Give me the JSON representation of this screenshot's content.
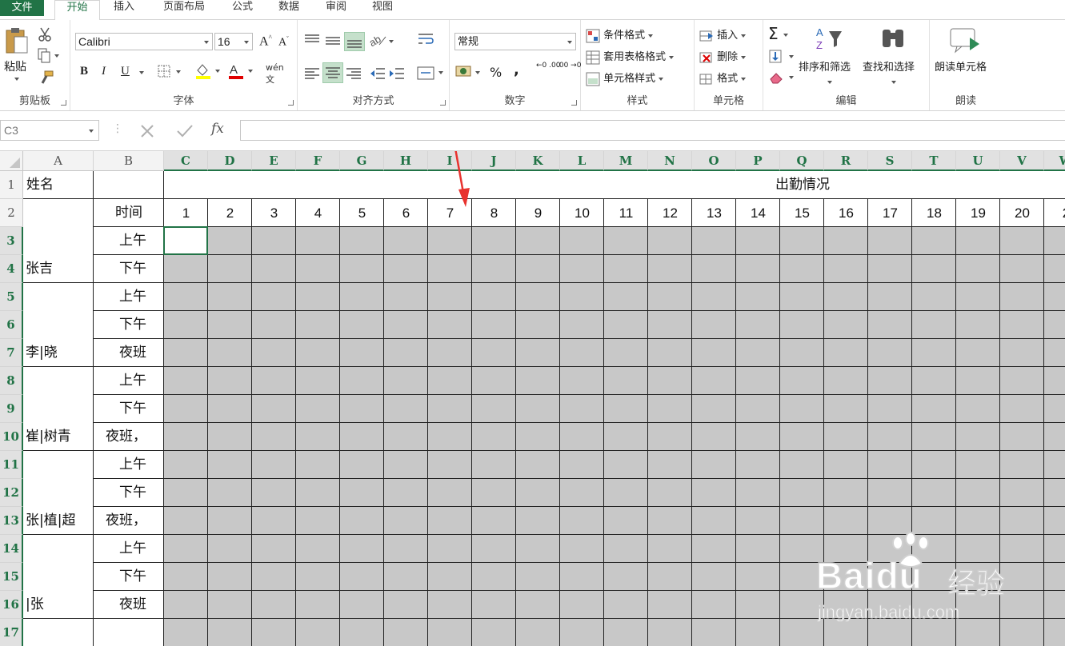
{
  "ribbon_tabs": [
    "文件",
    "开始",
    "插入",
    "页面布局",
    "公式",
    "数据",
    "审阅",
    "视图"
  ],
  "active_tab": "开始",
  "clipboard": {
    "paste": "粘贴",
    "group": "剪贴板"
  },
  "font": {
    "name": "Calibri",
    "size": "16",
    "bold": "B",
    "italic": "I",
    "underline": "U",
    "phonetic": "wén",
    "group": "字体"
  },
  "alignment": {
    "group": "对齐方式"
  },
  "number": {
    "format": "常规",
    "percent": "%",
    "comma": ",",
    "inc_decimal": "←0 .00",
    "dec_decimal": ".00 →0",
    "group": "数字"
  },
  "styles": {
    "conditional": "条件格式",
    "table": "套用表格格式",
    "cell_styles": "单元格样式",
    "group": "样式"
  },
  "cells": {
    "insert": "插入",
    "delete": "删除",
    "format": "格式",
    "group": "单元格"
  },
  "editing": {
    "sort": "排序和筛选",
    "find": "查找和选择",
    "group": "编辑"
  },
  "read": {
    "read_cells": "朗读单元格",
    "group": "朗读"
  },
  "formula_bar": {
    "name_box": "C3",
    "fx": "fx",
    "value": ""
  },
  "sheet": {
    "col_letters": [
      "A",
      "B",
      "C",
      "D",
      "E",
      "F",
      "G",
      "H",
      "I",
      "J",
      "K",
      "L",
      "M",
      "N",
      "O",
      "P",
      "Q",
      "R",
      "S",
      "T",
      "U",
      "V",
      "W"
    ],
    "row_numbers": [
      "1",
      "2",
      "3",
      "4",
      "5",
      "6",
      "7",
      "8",
      "9",
      "10",
      "11",
      "12",
      "13",
      "14",
      "15",
      "16",
      "17"
    ],
    "a1": "姓名",
    "b2": "时间",
    "title": "出勤情况",
    "days": [
      "1",
      "2",
      "3",
      "4",
      "5",
      "6",
      "7",
      "8",
      "9",
      "10",
      "11",
      "12",
      "13",
      "14",
      "15",
      "16",
      "17",
      "18",
      "19",
      "20",
      "2"
    ],
    "names": [
      "张吉",
      "李|晓",
      "崔|树青",
      "张|植|超",
      "|张"
    ],
    "shifts": [
      "上午",
      "下午",
      "上午",
      "下午",
      "夜班",
      "上午",
      "下午",
      "夜班，",
      "上午",
      "下午",
      "夜班，",
      "上午",
      "下午",
      "夜班"
    ]
  },
  "watermark": {
    "brand": "Baidu",
    "cn": "经验",
    "url": "jingyan.baidu.com"
  },
  "colors": {
    "accent": "#217346",
    "fill": "#c8c8c8",
    "arrow": "#e8332f"
  }
}
